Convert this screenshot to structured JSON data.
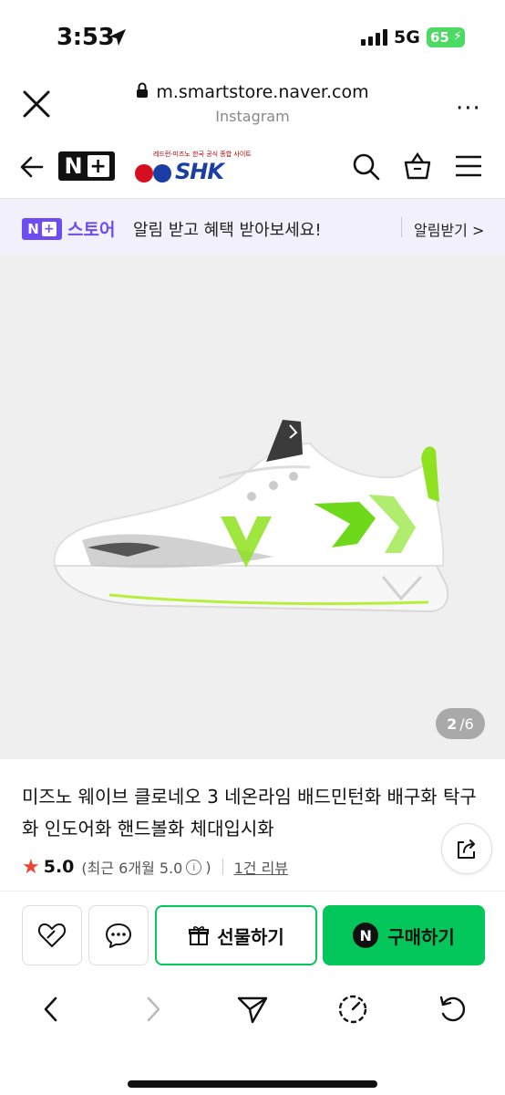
{
  "status_bar": {
    "time": "3:53",
    "network": "5G",
    "battery": "65"
  },
  "browser": {
    "url": "m.smartstore.naver.com",
    "source": "Instagram",
    "more": "···"
  },
  "site_header": {
    "nplus_logo": "N",
    "brand_tagline": "레드런·미즈노  한국 공식 종합 사이트",
    "brand_name": "SHK"
  },
  "banner": {
    "logo_text": "스토어",
    "logo_box": "N",
    "message": "알림 받고 혜택 받아보세요!",
    "action": "알림받기 >"
  },
  "product_image": {
    "current": "2",
    "total": "/6"
  },
  "product": {
    "title": "미즈노 웨이브 클로네오 3 네온라임 배드민턴화 배구화 탁구화 인도어화 핸드볼화 체대입시화",
    "rating": "5.0",
    "recent_rating": "(최근 6개월 5.0",
    "recent_close": ")",
    "info_icon": "i",
    "reviews": "1건 리뷰"
  },
  "actions": {
    "gift_label": "선물하기",
    "buy_label": "구매하기",
    "buy_badge": "N"
  },
  "colors": {
    "naver_green": "#03c75a",
    "store_purple": "#6d4cf2",
    "rating_star": "#f04433"
  }
}
